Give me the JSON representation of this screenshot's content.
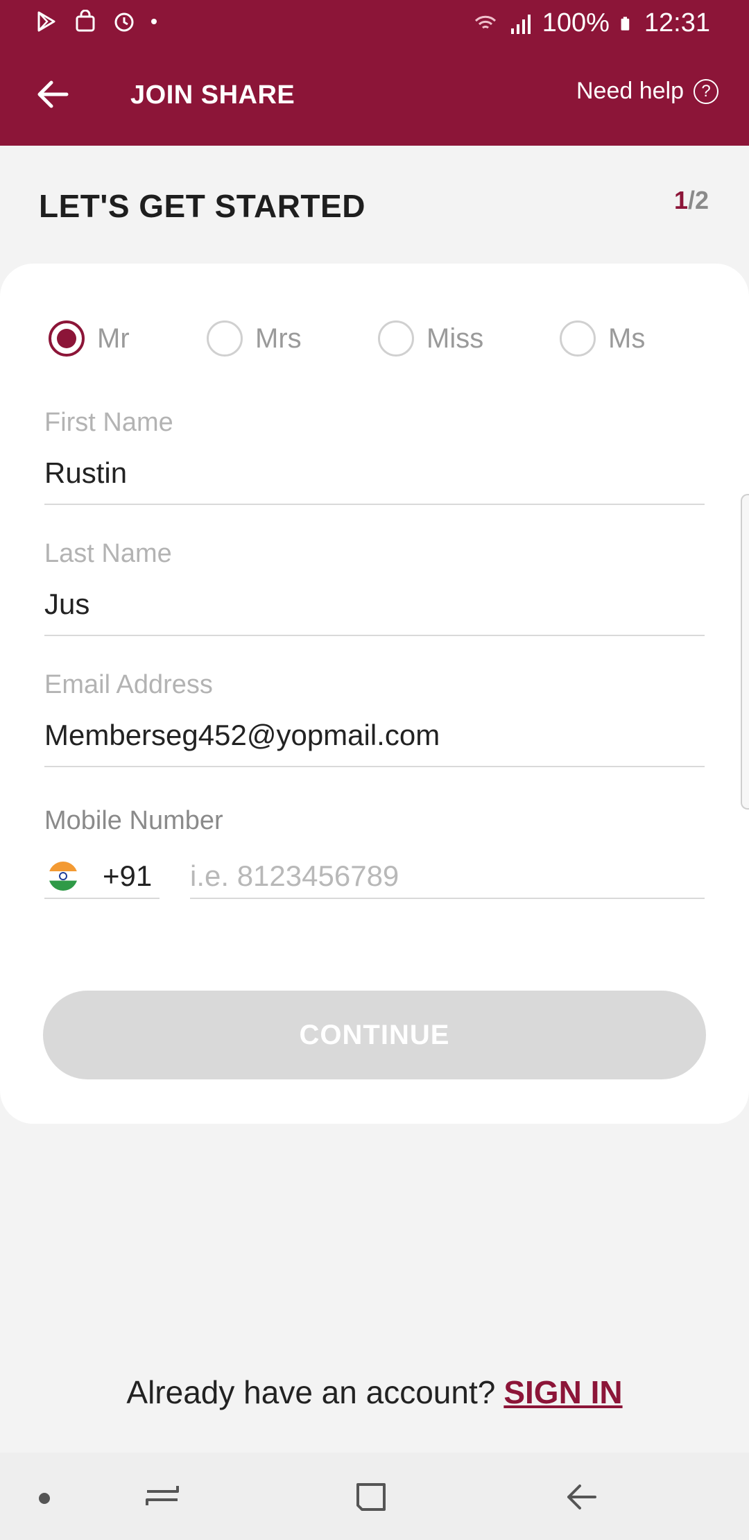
{
  "status_bar": {
    "battery": "100%",
    "time": "12:31"
  },
  "app_bar": {
    "title": "JOIN SHARE",
    "help_label": "Need help",
    "help_icon_glyph": "?"
  },
  "header": {
    "title": "LET'S GET STARTED",
    "step_current": "1",
    "step_total": "/2"
  },
  "titles": {
    "options": [
      "Mr",
      "Mrs",
      "Miss",
      "Ms"
    ],
    "selected": "Mr"
  },
  "form": {
    "first_name": {
      "label": "First Name",
      "value": "Rustin"
    },
    "last_name": {
      "label": "Last Name",
      "value": "Jus"
    },
    "email": {
      "label": "Email Address",
      "value": "Memberseg452@yopmail.com"
    },
    "mobile": {
      "label": "Mobile Number",
      "country_code": "+91",
      "country_flag": "india-flag-icon",
      "placeholder": "i.e. 8123456789"
    }
  },
  "continue_label": "CONTINUE",
  "signin": {
    "prompt": "Already have an account?",
    "link": "SIGN IN"
  },
  "colors": {
    "brand": "#8c1538",
    "disabled_button": "#d9d9d9",
    "background": "#f3f3f3"
  }
}
